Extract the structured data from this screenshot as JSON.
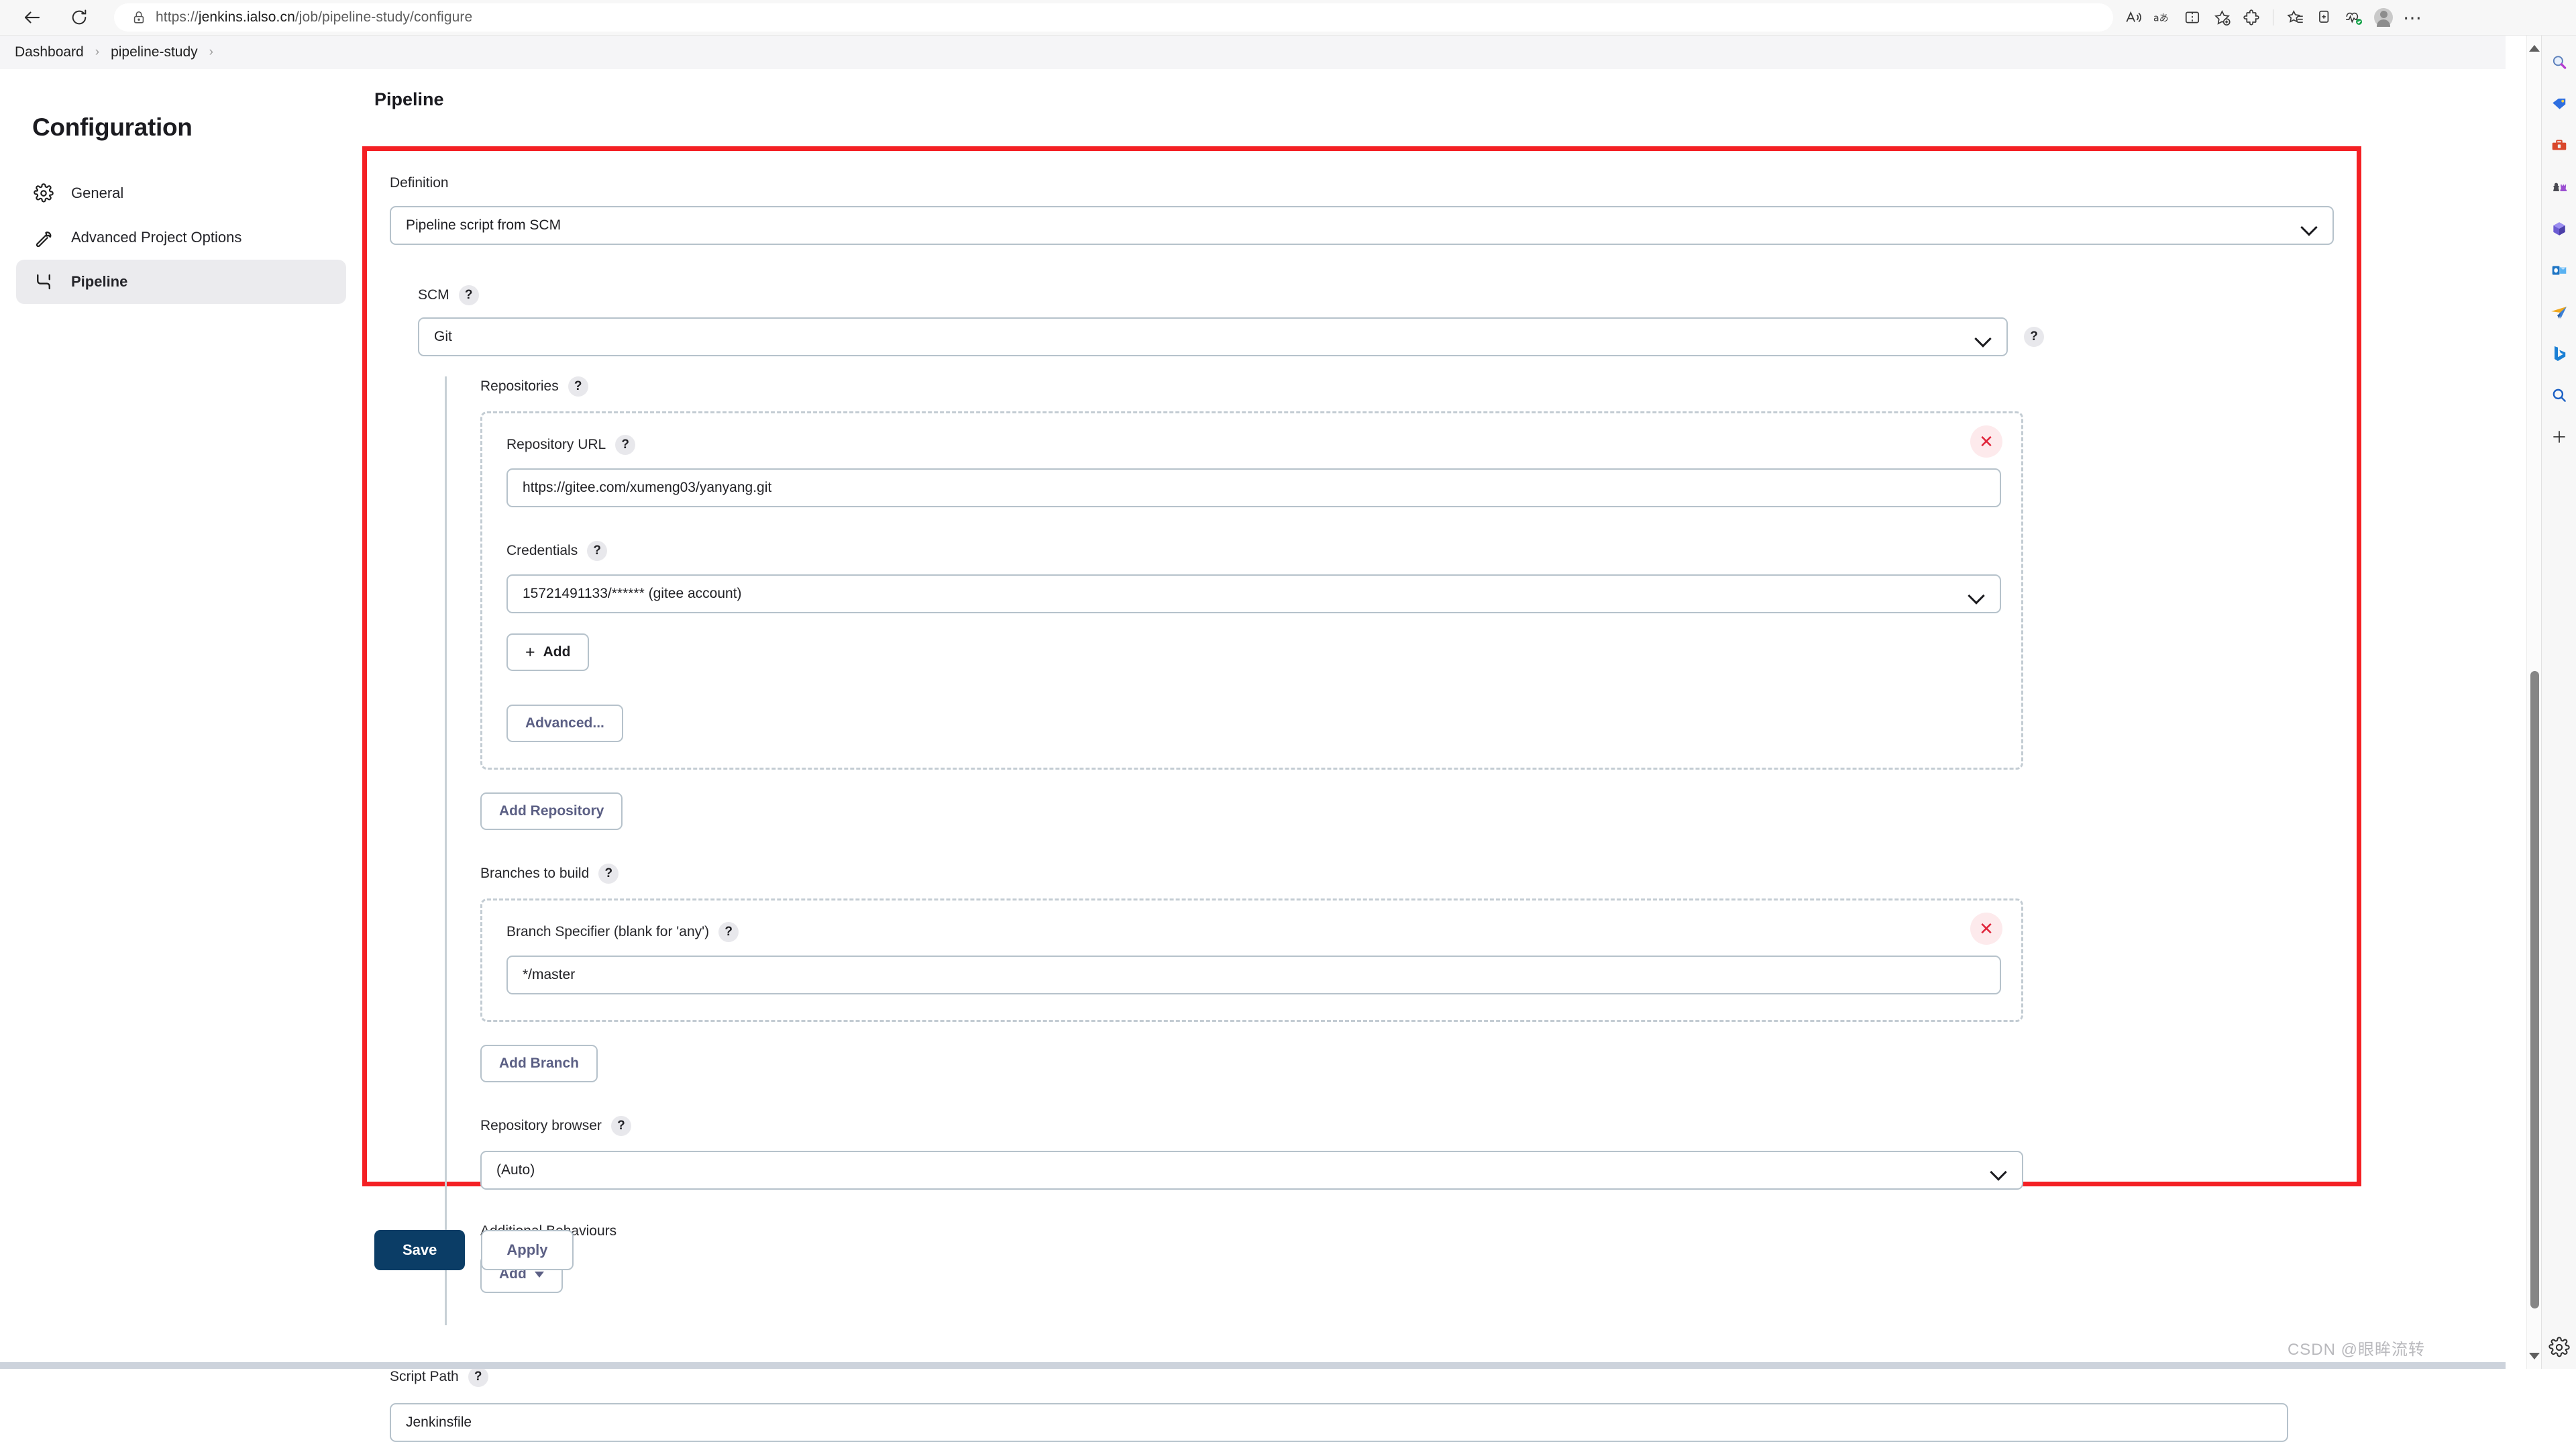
{
  "browser": {
    "back_icon": "back-arrow-icon",
    "reload_icon": "reload-icon",
    "lock_icon": "lock-icon",
    "url_scheme": "https://",
    "url_host": "jenkins.ialso.cn",
    "url_path": "/job/pipeline-study/configure",
    "toolbar_icons": [
      {
        "name": "read-aloud-icon",
        "glyph": "Ã"
      },
      {
        "name": "translate-icon",
        "glyph": "aあ"
      },
      {
        "name": "split-screen-icon",
        "glyph": "⌸"
      },
      {
        "name": "add-favorite-icon",
        "glyph": "☆"
      },
      {
        "name": "extensions-icon",
        "glyph": "⚙"
      },
      {
        "name": "collections-icon",
        "glyph": "☆"
      },
      {
        "name": "browser-essentials-icon",
        "glyph": "⊕"
      },
      {
        "name": "performance-icon",
        "glyph": "♥"
      },
      {
        "name": "profile-avatar",
        "glyph": ""
      },
      {
        "name": "settings-and-more-icon",
        "glyph": "⋯"
      }
    ],
    "edge_sidebar_icons": [
      {
        "name": "search-sidebar-icon",
        "glyph": "🔍"
      },
      {
        "name": "shopping-tag-icon",
        "glyph": "🏷"
      },
      {
        "name": "tools-box-icon",
        "glyph": "🧰"
      },
      {
        "name": "games-icon",
        "glyph": "♟"
      },
      {
        "name": "microsoft-365-icon",
        "glyph": "❖"
      },
      {
        "name": "outlook-icon",
        "glyph": "📧"
      },
      {
        "name": "drop-icon",
        "glyph": "✈"
      },
      {
        "name": "bing-icon",
        "glyph": "b"
      },
      {
        "name": "discover-search-icon",
        "glyph": "🔍"
      },
      {
        "name": "add-sidebar-icon",
        "glyph": "+"
      }
    ],
    "settings_gear_icon": "gear-icon"
  },
  "breadcrumb": {
    "items": [
      "Dashboard",
      "pipeline-study"
    ],
    "separator": "›"
  },
  "sidebar": {
    "title": "Configuration",
    "items": [
      {
        "label": "General",
        "icon": "gear-icon",
        "active": false
      },
      {
        "label": "Advanced Project Options",
        "icon": "wrench-icon",
        "active": false
      },
      {
        "label": "Pipeline",
        "icon": "pipeline-icon",
        "active": true
      }
    ]
  },
  "main": {
    "section_title": "Pipeline",
    "definition": {
      "label": "Definition",
      "value": "Pipeline script from SCM"
    },
    "scm": {
      "label": "SCM",
      "help": "?",
      "value": "Git",
      "trailing_help": "?"
    },
    "repositories": {
      "label": "Repositories",
      "help": "?",
      "close_icon": "✕",
      "repository_url": {
        "label": "Repository URL",
        "help": "?",
        "value": "https://gitee.com/xumeng03/yanyang.git"
      },
      "credentials": {
        "label": "Credentials",
        "help": "?",
        "value": "15721491133/****** (gitee account)"
      },
      "add_button": "Add",
      "add_plus": "+",
      "advanced_button": "Advanced...",
      "add_repository_button": "Add Repository"
    },
    "branches": {
      "label": "Branches to build",
      "help": "?",
      "close_icon": "✕",
      "branch_specifier": {
        "label": "Branch Specifier (blank for 'any')",
        "help": "?",
        "value": "*/master"
      },
      "add_branch_button": "Add Branch"
    },
    "repository_browser": {
      "label": "Repository browser",
      "help": "?",
      "value": "(Auto)"
    },
    "additional_behaviours": {
      "label": "Additional Behaviours",
      "add_button": "Add"
    },
    "script_path": {
      "label": "Script Path",
      "help": "?",
      "value": "Jenkinsfile"
    }
  },
  "actions": {
    "save_label": "Save",
    "apply_label": "Apply"
  },
  "watermark": "CSDN @眼眸流转",
  "colors": {
    "highlight_border": "#f42024",
    "save_button": "#0b3d66",
    "active_nav": "#ebebee",
    "field_border": "#b6c2cb",
    "link_text": "#5b5f84"
  }
}
